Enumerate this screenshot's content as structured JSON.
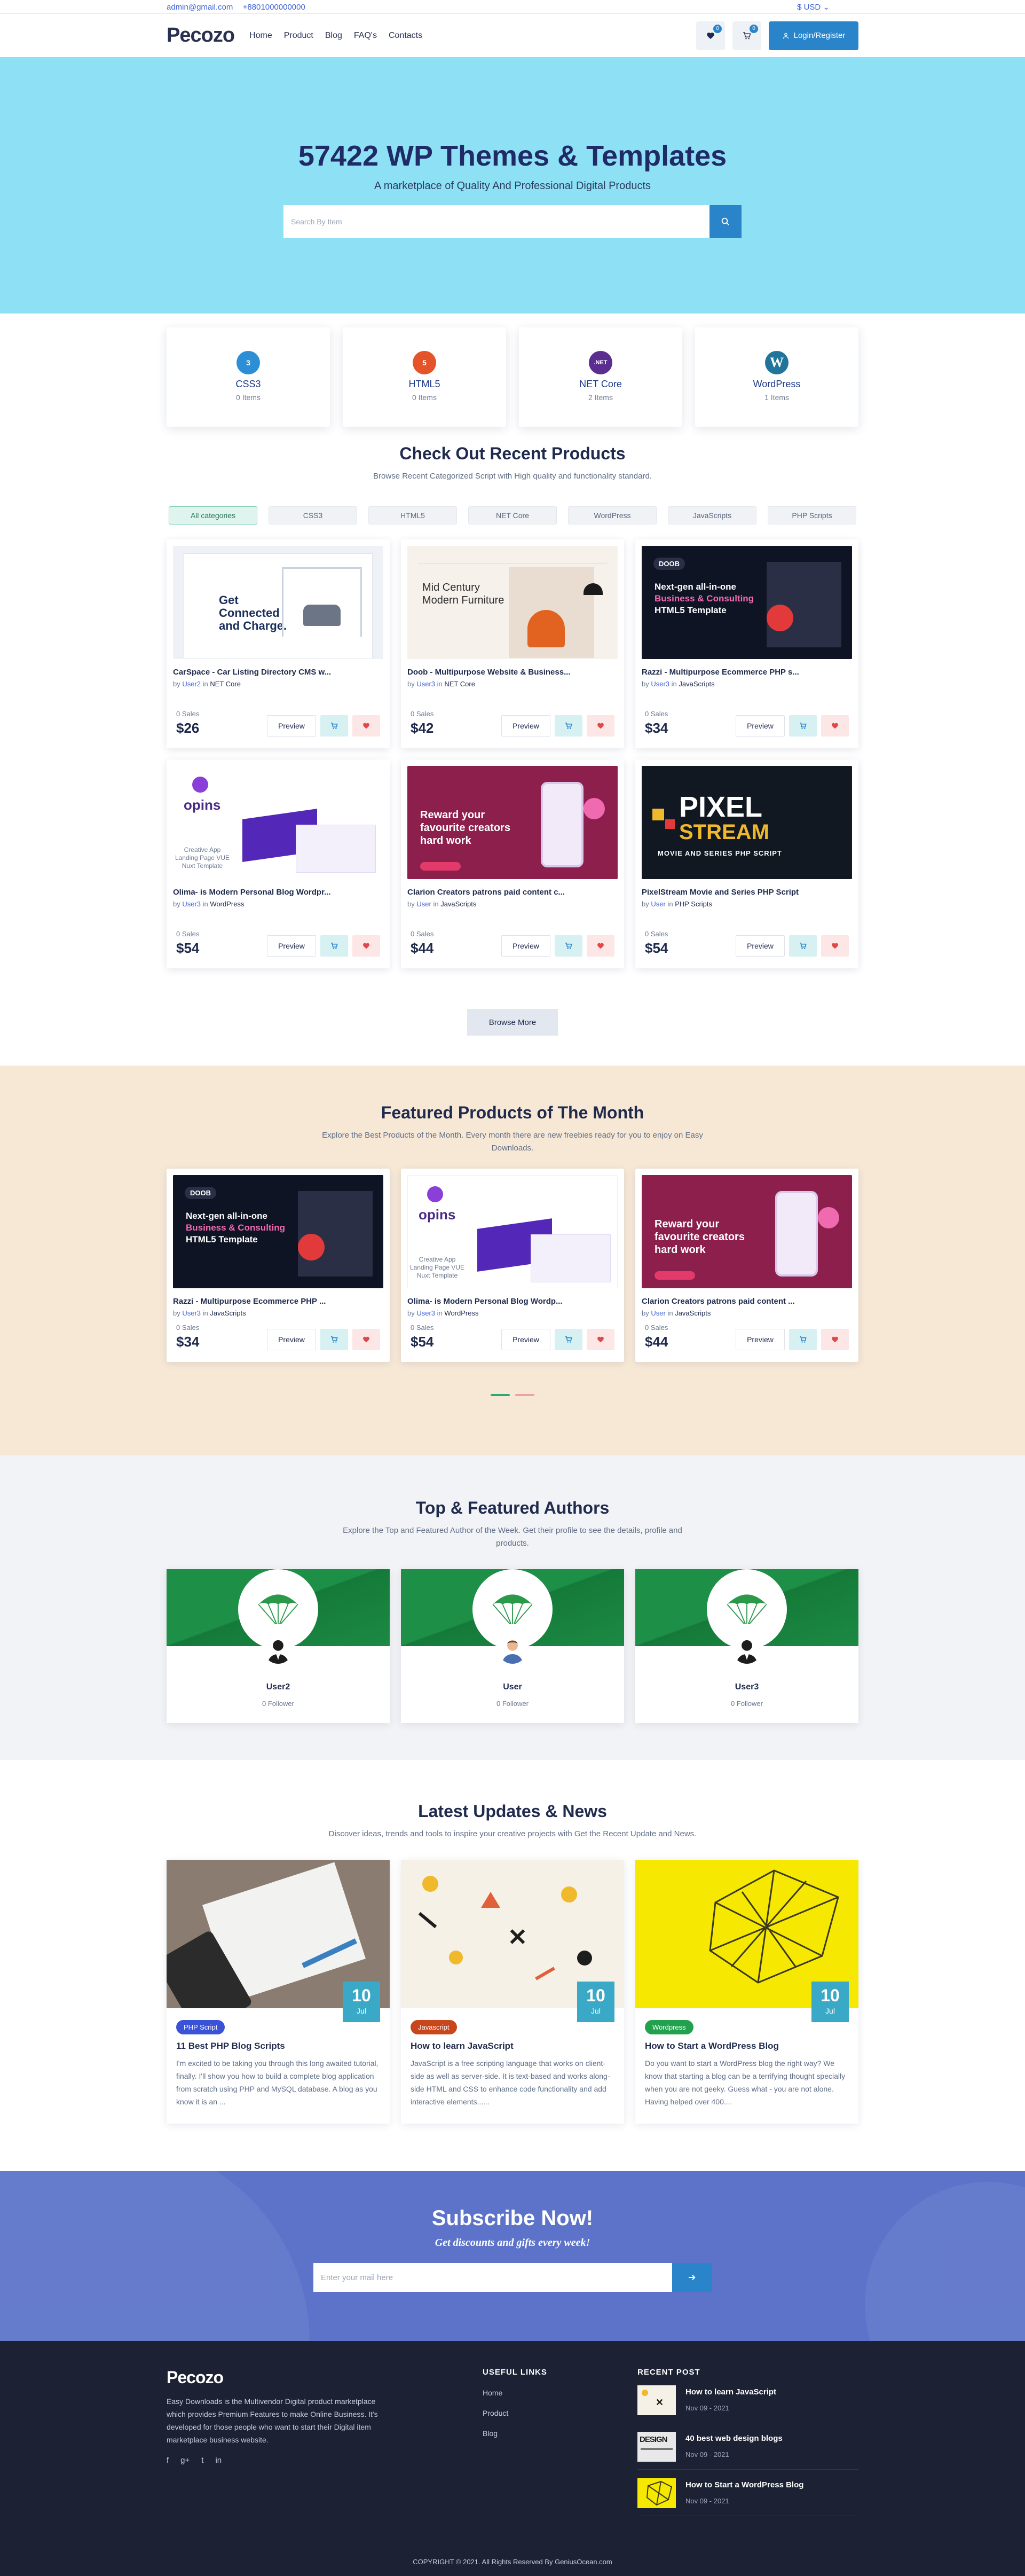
{
  "topbar": {
    "email": "admin@gmail.com",
    "phone": "+8801000000000",
    "currency": "$ USD"
  },
  "header": {
    "logo": "Pecozo",
    "nav": [
      "Home",
      "Product",
      "Blog",
      "FAQ's",
      "Contacts"
    ],
    "wishlist_count": "0",
    "cart_count": "0",
    "login_label": "Login/Register"
  },
  "hero": {
    "title": "57422 WP Themes & Templates",
    "subtitle": "A marketplace of Quality And Professional Digital Products",
    "search_placeholder": "Search By Item"
  },
  "categories": [
    {
      "name": "CSS3",
      "count": "0 Items",
      "icon": "css3-icon",
      "color": "#2c8fd6",
      "glyph": "3"
    },
    {
      "name": "HTML5",
      "count": "0 Items",
      "icon": "html5-icon",
      "color": "#e4532a",
      "glyph": "5"
    },
    {
      "name": "NET Core",
      "count": "2 Items",
      "icon": "net-core-icon",
      "color": "#5b2d91",
      "glyph": ".NET"
    },
    {
      "name": "WordPress",
      "count": "1 Items",
      "icon": "wordpress-icon",
      "color": "#21759b",
      "glyph": "W"
    }
  ],
  "recent": {
    "title": "Check Out Recent Products",
    "subtitle": "Browse Recent Categorized Script with High quality and functionality standard.",
    "filters": [
      "All categories",
      "CSS3",
      "HTML5",
      "NET Core",
      "WordPress",
      "JavaScripts",
      "PHP Scripts"
    ],
    "browse_label": "Browse More",
    "products": [
      {
        "title": "CarSpace - Car Listing Directory CMS w...",
        "by": "by",
        "user": "User2",
        "in": "in",
        "cat": "NET Core",
        "sales": "0 Sales",
        "price": "$26",
        "preview": "Preview"
      },
      {
        "title": "Doob - Multipurpose Website & Business...",
        "by": "by",
        "user": "User3",
        "in": "in",
        "cat": "NET Core",
        "sales": "0 Sales",
        "price": "$42",
        "preview": "Preview"
      },
      {
        "title": "Razzi - Multipurpose Ecommerce PHP s...",
        "by": "by",
        "user": "User3",
        "in": "in",
        "cat": "JavaScripts",
        "sales": "0 Sales",
        "price": "$34",
        "preview": "Preview"
      },
      {
        "title": "Olima- is Modern Personal Blog Wordpr...",
        "by": "by",
        "user": "User3",
        "in": "in",
        "cat": "WordPress",
        "sales": "0 Sales",
        "price": "$54",
        "preview": "Preview"
      },
      {
        "title": "Clarion Creators patrons paid content c...",
        "by": "by",
        "user": "User",
        "in": "in",
        "cat": "JavaScripts",
        "sales": "0 Sales",
        "price": "$44",
        "preview": "Preview"
      },
      {
        "title": "PixelStream Movie and Series PHP Script",
        "by": "by",
        "user": "User",
        "in": "in",
        "cat": "PHP Scripts",
        "sales": "0 Sales",
        "price": "$54",
        "preview": "Preview"
      }
    ],
    "thumb_text": {
      "carspace_title": "Get Connected and Charge.",
      "doob_title": "Mid Century Modern Furniture",
      "razzi_brand": "DOOB",
      "razzi_line1": "Next-gen all-in-one",
      "razzi_line2": "Business & Consulting",
      "razzi_line3": "HTML5 Template",
      "opins_brand": "opins",
      "opins_note": "Creative App Landing Page VUE Nuxt Template",
      "clarion_title": "Reward your favourite creators hard work",
      "pixel_line1": "PIXEL",
      "pixel_line2": "STREAM",
      "pixel_line3": "MOVIE AND SERIES PHP SCRIPT"
    }
  },
  "featured": {
    "title": "Featured Products of The Month",
    "subtitle": "Explore the Best Products of the Month. Every month there are new freebies ready for you to enjoy on Easy Downloads.",
    "products": [
      {
        "title": "Razzi - Multipurpose Ecommerce PHP ...",
        "by": "by",
        "user": "User3",
        "in": "in",
        "cat": "JavaScripts",
        "sales": "0 Sales",
        "price": "$34",
        "preview": "Preview"
      },
      {
        "title": "Olima- is Modern Personal Blog Wordp...",
        "by": "by",
        "user": "User3",
        "in": "in",
        "cat": "WordPress",
        "sales": "0 Sales",
        "price": "$54",
        "preview": "Preview"
      },
      {
        "title": "Clarion Creators patrons paid content ...",
        "by": "by",
        "user": "User",
        "in": "in",
        "cat": "JavaScripts",
        "sales": "0 Sales",
        "price": "$44",
        "preview": "Preview"
      }
    ]
  },
  "authors": {
    "title": "Top & Featured Authors",
    "subtitle": "Explore the Top and Featured Author of the Week. Get their profile to see the details, profile and products.",
    "list": [
      {
        "name": "User2",
        "followers": "0 Follower"
      },
      {
        "name": "User",
        "followers": "0 Follower"
      },
      {
        "name": "User3",
        "followers": "0 Follower"
      }
    ]
  },
  "news": {
    "title": "Latest Updates & News",
    "subtitle": "Discover ideas, trends and tools to inspire your creative projects with Get the Recent Update and News.",
    "posts": [
      {
        "day": "10",
        "month": "Jul",
        "tag": "PHP Script",
        "tag_color": "#3a52d8",
        "title": "11 Best PHP Blog Scripts",
        "excerpt": "I'm excited to be taking you through this long awaited tutorial, finally. I'll show you how to build a complete blog application from scratch using PHP and MySQL database. A blog as you know it is an ..."
      },
      {
        "day": "10",
        "month": "Jul",
        "tag": "Javascript",
        "tag_color": "#c9451b",
        "title": "How to learn JavaScript",
        "excerpt": "JavaScript is a free scripting language that works on client-side as well as server-side. It is text-based and works along-side HTML and CSS to enhance code functionality and add interactive elements......"
      },
      {
        "day": "10",
        "month": "Jul",
        "tag": "Wordpress",
        "tag_color": "#23a04e",
        "title": "How to Start a WordPress Blog",
        "excerpt": "Do you want to start a WordPress blog the right way? We know that starting a blog can be a terrifying thought specially when you are not geeky. Guess what - you are not alone. Having helped over 400...."
      }
    ]
  },
  "subscribe": {
    "title": "Subscribe Now!",
    "subtitle": "Get discounts and gifts every week!",
    "placeholder": "Enter your mail here"
  },
  "footer": {
    "logo": "Pecozo",
    "description": "Easy Downloads is the Multivendor Digital product marketplace which provides Premium Features to make Online Business. It's developed for those people who want to start their Digital item marketplace business website.",
    "social": [
      "f",
      "g+",
      "t",
      "in"
    ],
    "useful_title": "USEFUL LINKS",
    "useful_links": [
      "Home",
      "Product",
      "Blog"
    ],
    "recent_title": "RECENT POST",
    "recent_posts": [
      {
        "title": "How to learn JavaScript",
        "date": "Nov 09 - 2021"
      },
      {
        "title": "40 best web design blogs",
        "date": "Nov 09 - 2021",
        "thumb_text": "DESIGN"
      },
      {
        "title": "How to Start a WordPress Blog",
        "date": "Nov 09 - 2021"
      }
    ],
    "copyright": "COPYRIGHT © 2021. All Rights Reserved By GeniusOcean.com"
  }
}
